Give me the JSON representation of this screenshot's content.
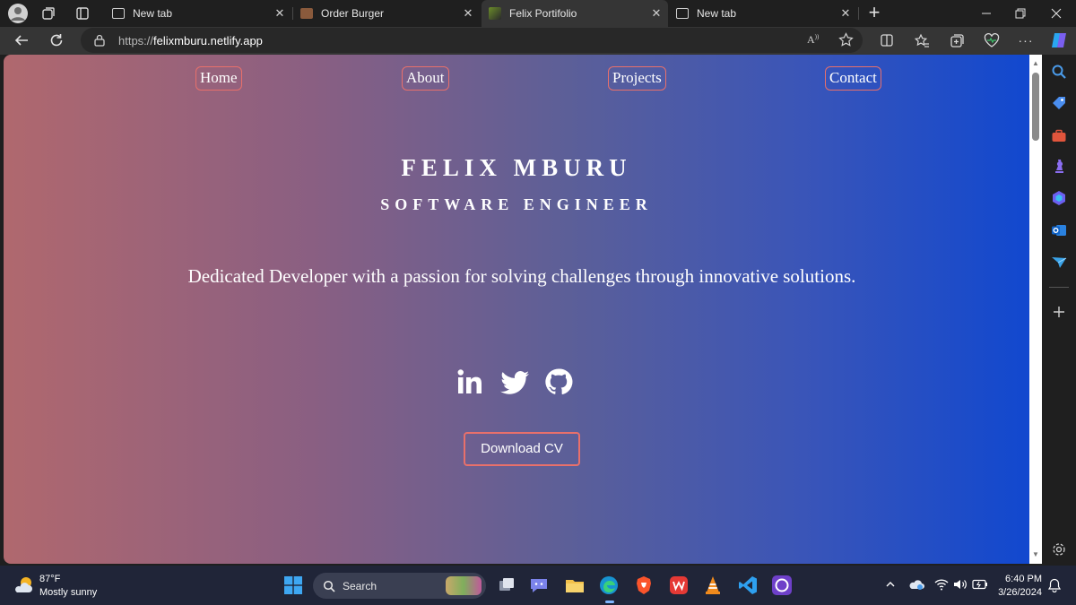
{
  "browser": {
    "tabs": [
      {
        "title": "New tab",
        "active": false
      },
      {
        "title": "Order Burger",
        "active": false
      },
      {
        "title": "Felix Portifolio",
        "active": true
      },
      {
        "title": "New tab",
        "active": false
      }
    ],
    "new_tab_glyph": "+",
    "address": {
      "scheme": "https://",
      "host": "felixmburu.netlify.app"
    }
  },
  "page": {
    "nav": [
      "Home",
      "About",
      "Projects",
      "Contact"
    ],
    "name": "FELIX MBURU",
    "role": "SOFTWARE ENGINEER",
    "tagline": "Dedicated Developer with a passion for solving challenges through innovative solutions.",
    "social": [
      "linkedin-icon",
      "twitter-icon",
      "github-icon"
    ],
    "cv_button": "Download CV",
    "accent_border": "#e8706b",
    "gradient": [
      "#b0686e",
      "#1148cf"
    ]
  },
  "taskbar": {
    "weather_temp": "87°F",
    "weather_desc": "Mostly sunny",
    "search_label": "Search",
    "time": "6:40 PM",
    "date": "3/26/2024"
  }
}
